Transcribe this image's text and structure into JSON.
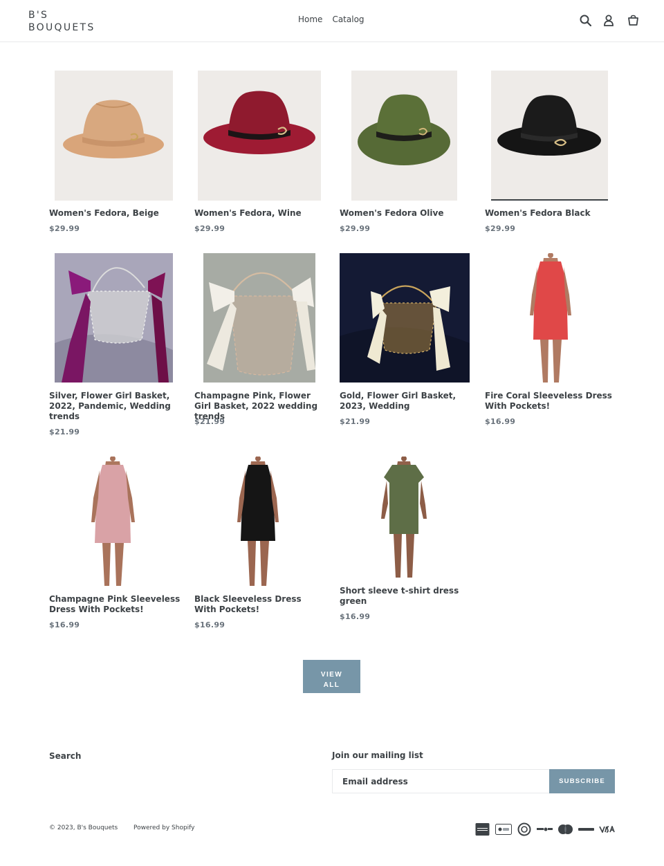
{
  "header": {
    "logo_line1": "B'S",
    "logo_line2": "BOUQUETS",
    "nav": [
      "Home",
      "Catalog"
    ]
  },
  "products": [
    {
      "title": "Women's Fedora, Beige",
      "price": "$29.99",
      "image": "beige-fedora"
    },
    {
      "title": "Women's Fedora, Wine",
      "price": "$29.99",
      "image": "wine-fedora"
    },
    {
      "title": "Women's Fedora Olive",
      "price": "$29.99",
      "image": "olive-fedora"
    },
    {
      "title": "Women's Fedora Black",
      "price": "$29.99",
      "image": "black-fedora"
    },
    {
      "title": "Silver, Flower Girl Basket, 2022, Pandemic, Wedding trends",
      "price": "$21.99",
      "image": "silver-basket"
    },
    {
      "title": "Champagne Pink, Flower Girl Basket, 2022 wedding trends",
      "price": "$21.99",
      "image": "champagne-basket"
    },
    {
      "title": "Gold, Flower Girl Basket, 2023, Wedding",
      "price": "$21.99",
      "image": "gold-basket"
    },
    {
      "title": "Fire Coral Sleeveless Dress With Pockets!",
      "price": "$16.99",
      "image": "coral-dress"
    },
    {
      "title": "Champagne Pink Sleeveless Dress With Pockets!",
      "price": "$16.99",
      "image": "pink-dress"
    },
    {
      "title": "Black Sleeveless Dress With Pockets!",
      "price": "$16.99",
      "image": "black-dress"
    },
    {
      "title": "Short sleeve t-shirt dress green",
      "price": "$16.99",
      "image": "green-tshirt-dress"
    }
  ],
  "view_all": {
    "line1": "VIEW",
    "line2": "ALL"
  },
  "footer": {
    "search_link": "Search",
    "mailing_title": "Join our mailing list",
    "email_placeholder": "Email address",
    "subscribe_label": "SUBSCRIBE",
    "copyright": "© 2023, B's Bouquets",
    "powered": "Powered by Shopify",
    "payment_icons": [
      "amex-icon",
      "apple-pay-icon",
      "diners-club-icon",
      "discover-icon",
      "mastercard-icon",
      "paypal-icon",
      "visa-icon"
    ]
  },
  "colors": {
    "accent": "#7796a8",
    "text": "#3d4246",
    "price": "#69727b"
  }
}
